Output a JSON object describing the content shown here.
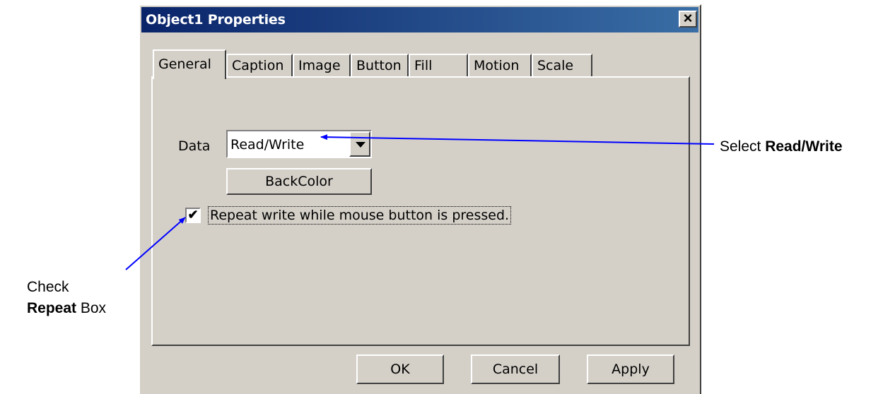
{
  "dialog": {
    "title": "Object1 Properties",
    "close_label": "×",
    "tabs": [
      {
        "label": "General"
      },
      {
        "label": "Caption"
      },
      {
        "label": "Image"
      },
      {
        "label": "Button"
      },
      {
        "label": "Fill"
      },
      {
        "label": "Motion"
      },
      {
        "label": "Scale"
      }
    ],
    "data_label": "Data",
    "data_value": "Read/Write",
    "backcolor_label": "BackColor",
    "repeat_checkbox": {
      "checked": true,
      "mark": "✔",
      "label": "Repeat write while mouse button is pressed."
    },
    "buttons": {
      "ok": "OK",
      "cancel": "Cancel",
      "apply": "Apply"
    }
  },
  "annotations": {
    "select_prefix": "Select ",
    "select_bold": "Read/Write",
    "check_line1": "Check",
    "check_bold": "Repeat",
    "check_suffix": " Box"
  },
  "colors": {
    "title_start": "#0a246a",
    "title_end": "#3a6ea5",
    "arrow": "#0000ff",
    "face": "#d4d0c8"
  }
}
